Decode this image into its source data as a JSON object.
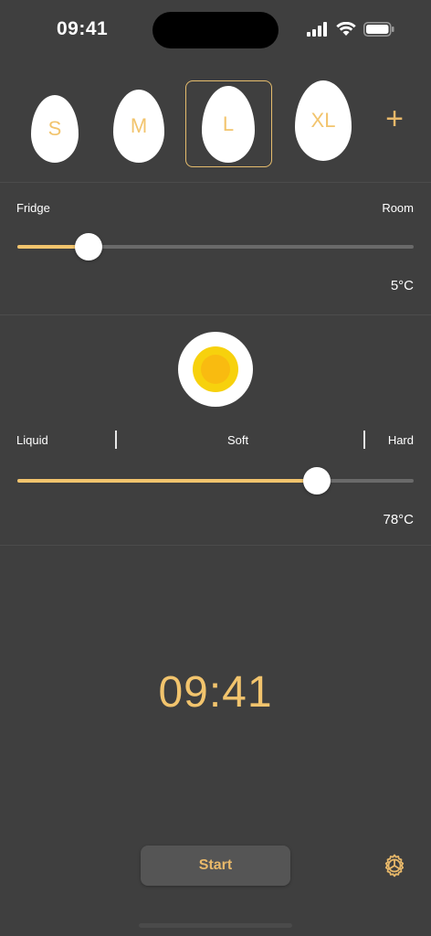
{
  "status_bar": {
    "time": "09:41",
    "icons": [
      "signal-icon",
      "wifi-icon",
      "battery-icon"
    ]
  },
  "egg_sizes": {
    "items": [
      {
        "label": "S"
      },
      {
        "label": "M"
      },
      {
        "label": "L",
        "selected": true
      },
      {
        "label": "XL"
      }
    ],
    "add_label": "+"
  },
  "temperature": {
    "min_label": "Fridge",
    "max_label": "Room",
    "value_label": "5°C",
    "slider_fraction": 0.18
  },
  "doneness": {
    "labels": {
      "liquid": "Liquid",
      "soft": "Soft",
      "hard": "Hard"
    },
    "value_label": "78°C",
    "slider_fraction": 0.755
  },
  "timer": {
    "display": "09:41"
  },
  "actions": {
    "start_label": "Start"
  },
  "colors": {
    "background": "#3f3f3f",
    "accent": "#f2c46d",
    "yolk": "#f7d10d"
  }
}
